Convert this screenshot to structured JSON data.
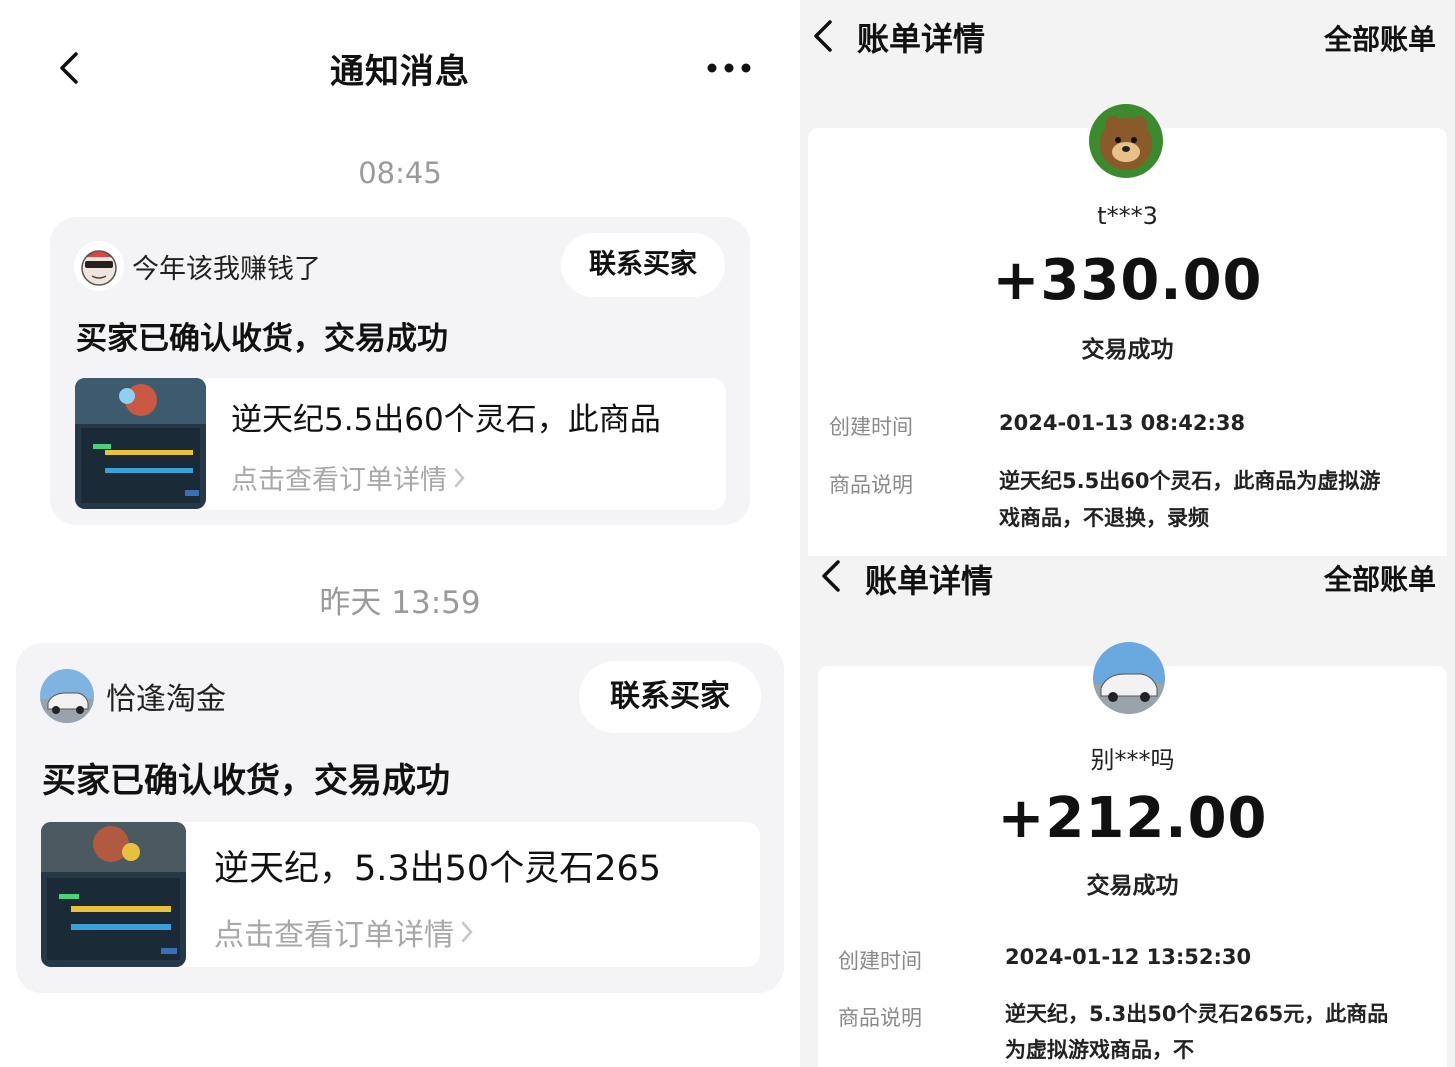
{
  "notifications": {
    "title": "通知消息",
    "groups": [
      {
        "time": "08:45",
        "seller": "今年该我赚钱了",
        "contact_label": "联系买家",
        "message": "买家已确认收货，交易成功",
        "product_name": "逆天纪5.5出60个灵石，此商品",
        "link_label": "点击查看订单详情"
      },
      {
        "time": "昨天 13:59",
        "seller": "恰逢淘金",
        "contact_label": "联系买家",
        "message": "买家已确认收货，交易成功",
        "product_name": "逆天纪，5.3出50个灵石265",
        "link_label": "点击查看订单详情"
      }
    ]
  },
  "bills": [
    {
      "title": "账单详情",
      "all_label": "全部账单",
      "user": "t***3",
      "amount": "+330.00",
      "status": "交易成功",
      "created_label": "创建时间",
      "created_value": "2024-01-13 08:42:38",
      "desc_label": "商品说明",
      "desc_line1": "逆天纪5.5出60个灵石，此商品为虚拟游",
      "desc_line2": "戏商品，不退换，录频"
    },
    {
      "title": "账单详情",
      "all_label": "全部账单",
      "user": "别***吗",
      "amount": "+212.00",
      "status": "交易成功",
      "created_label": "创建时间",
      "created_value": "2024-01-12 13:52:30",
      "desc_label": "商品说明",
      "desc_line1": "逆天纪，5.3出50个灵石265元，此商品",
      "desc_line2": "为虚拟游戏商品，不"
    }
  ],
  "icons": {
    "back": "chevron-left-icon",
    "more": "more-horizontal-icon",
    "link_arrow": "chevron-right-icon"
  }
}
